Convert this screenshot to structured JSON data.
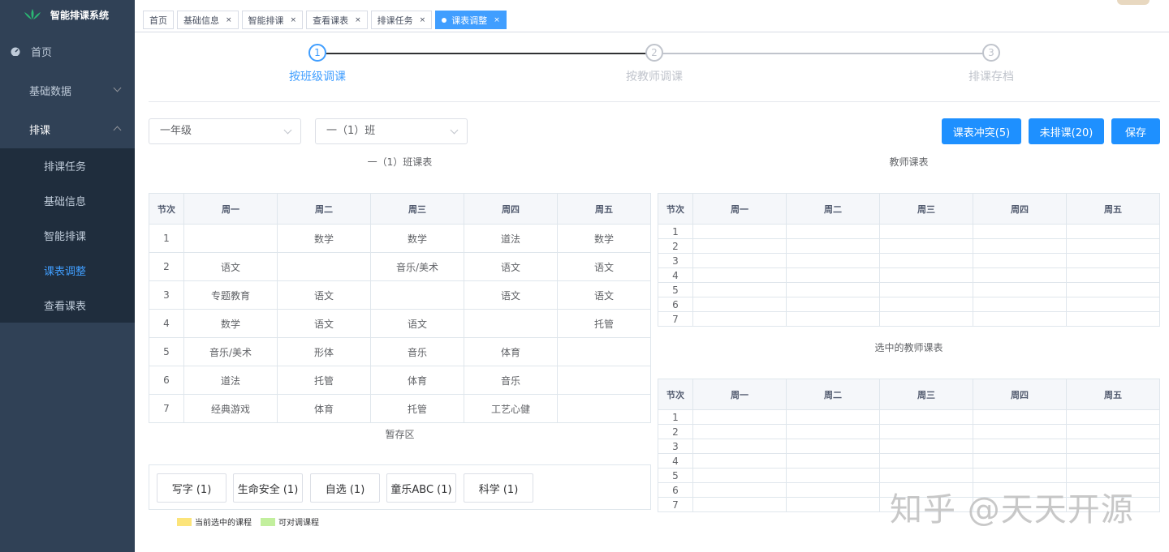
{
  "app": {
    "title": "智能排课系统"
  },
  "sidebar": {
    "home": "首页",
    "basic_data": "基础数据",
    "scheduling": "排课",
    "sub_items": [
      {
        "label": "排课任务",
        "active": false
      },
      {
        "label": "基础信息",
        "active": false
      },
      {
        "label": "智能排课",
        "active": false
      },
      {
        "label": "课表调整",
        "active": true
      },
      {
        "label": "查看课表",
        "active": false
      }
    ]
  },
  "tags": [
    {
      "label": "首页",
      "closable": false,
      "active": false
    },
    {
      "label": "基础信息",
      "closable": true,
      "active": false
    },
    {
      "label": "智能排课",
      "closable": true,
      "active": false
    },
    {
      "label": "查看课表",
      "closable": true,
      "active": false
    },
    {
      "label": "排课任务",
      "closable": true,
      "active": false
    },
    {
      "label": "课表调整",
      "closable": true,
      "active": true
    }
  ],
  "steps": [
    {
      "num": "1",
      "title": "按班级调课",
      "active": true
    },
    {
      "num": "2",
      "title": "按教师调课",
      "active": false
    },
    {
      "num": "3",
      "title": "排课存档",
      "active": false
    }
  ],
  "filters": {
    "grade": "一年级",
    "class": "一（1）班"
  },
  "buttons": {
    "conflict": "课表冲突(5)",
    "unscheduled": "未排课(20)",
    "save": "保存"
  },
  "class_table": {
    "caption": "一（1）班课表",
    "headers": [
      "节次",
      "周一",
      "周二",
      "周三",
      "周四",
      "周五"
    ],
    "rows": [
      [
        "1",
        "",
        "数学",
        "数学",
        "道法",
        "数学"
      ],
      [
        "2",
        "语文",
        "",
        "音乐/美术",
        "语文",
        "语文"
      ],
      [
        "3",
        "专题教育",
        "语文",
        "",
        "语文",
        "语文"
      ],
      [
        "4",
        "数学",
        "语文",
        "语文",
        "",
        "托管"
      ],
      [
        "5",
        "音乐/美术",
        "形体",
        "音乐",
        "体育",
        ""
      ],
      [
        "6",
        "道法",
        "托管",
        "体育",
        "音乐",
        ""
      ],
      [
        "7",
        "经典游戏",
        "体育",
        "托管",
        "工艺心健",
        ""
      ]
    ]
  },
  "teacher_table": {
    "caption": "教师课表",
    "headers": [
      "节次",
      "周一",
      "周二",
      "周三",
      "周四",
      "周五"
    ],
    "periods": [
      "1",
      "2",
      "3",
      "4",
      "5",
      "6",
      "7"
    ]
  },
  "selected_teacher_table": {
    "caption": "选中的教师课表",
    "headers": [
      "节次",
      "周一",
      "周二",
      "周三",
      "周四",
      "周五"
    ],
    "periods": [
      "1",
      "2",
      "3",
      "4",
      "5",
      "6",
      "7"
    ]
  },
  "staging": {
    "caption": "暂存区",
    "chips": [
      "写字 (1)",
      "生命安全 (1)",
      "自选 (1)",
      "童乐ABC (1)",
      "科学 (1)"
    ]
  },
  "legend": [
    {
      "label": "当前选中的课程",
      "color": "#fce47a"
    },
    {
      "label": "可对调课程",
      "color": "#c2ef9d"
    }
  ],
  "watermark": "知乎 @天天开源",
  "colors": {
    "sidebar": "#304156",
    "submenu": "#1f2d3d",
    "primary": "#1e90ff",
    "active_menu": "#409eff"
  }
}
